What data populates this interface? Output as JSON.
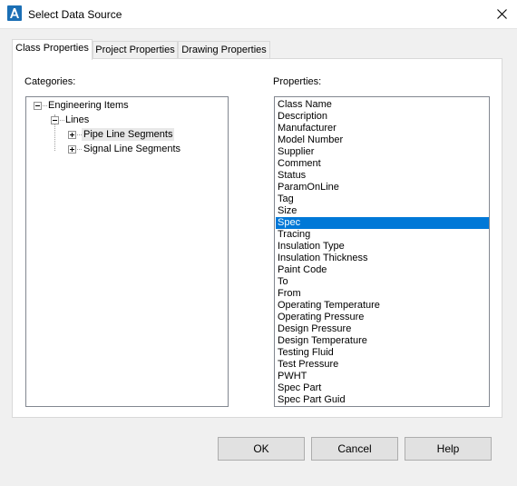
{
  "window": {
    "title": "Select Data Source"
  },
  "tabs": [
    {
      "label": "Class Properties",
      "active": true
    },
    {
      "label": "Project Properties",
      "active": false
    },
    {
      "label": "Drawing Properties",
      "active": false
    }
  ],
  "categories": {
    "label": "Categories:",
    "tree": {
      "root": "Engineering Items",
      "child": "Lines",
      "leaves": [
        "Pipe Line Segments",
        "Signal Line Segments"
      ]
    }
  },
  "properties": {
    "label": "Properties:",
    "selected": "Spec",
    "items": [
      "Class Name",
      "Description",
      "Manufacturer",
      "Model Number",
      "Supplier",
      "Comment",
      "Status",
      "ParamOnLine",
      "Tag",
      "Size",
      "Spec",
      "Tracing",
      "Insulation Type",
      "Insulation Thickness",
      "Paint Code",
      "To",
      "From",
      "Operating Temperature",
      "Operating Pressure",
      "Design Pressure",
      "Design Temperature",
      "Testing Fluid",
      "Test Pressure",
      "PWHT",
      "Spec Part",
      "Spec Part Guid"
    ]
  },
  "buttons": {
    "ok": "OK",
    "cancel": "Cancel",
    "help": "Help"
  },
  "colors": {
    "selection": "#0078d7",
    "app_icon": "#1b6fb5"
  }
}
